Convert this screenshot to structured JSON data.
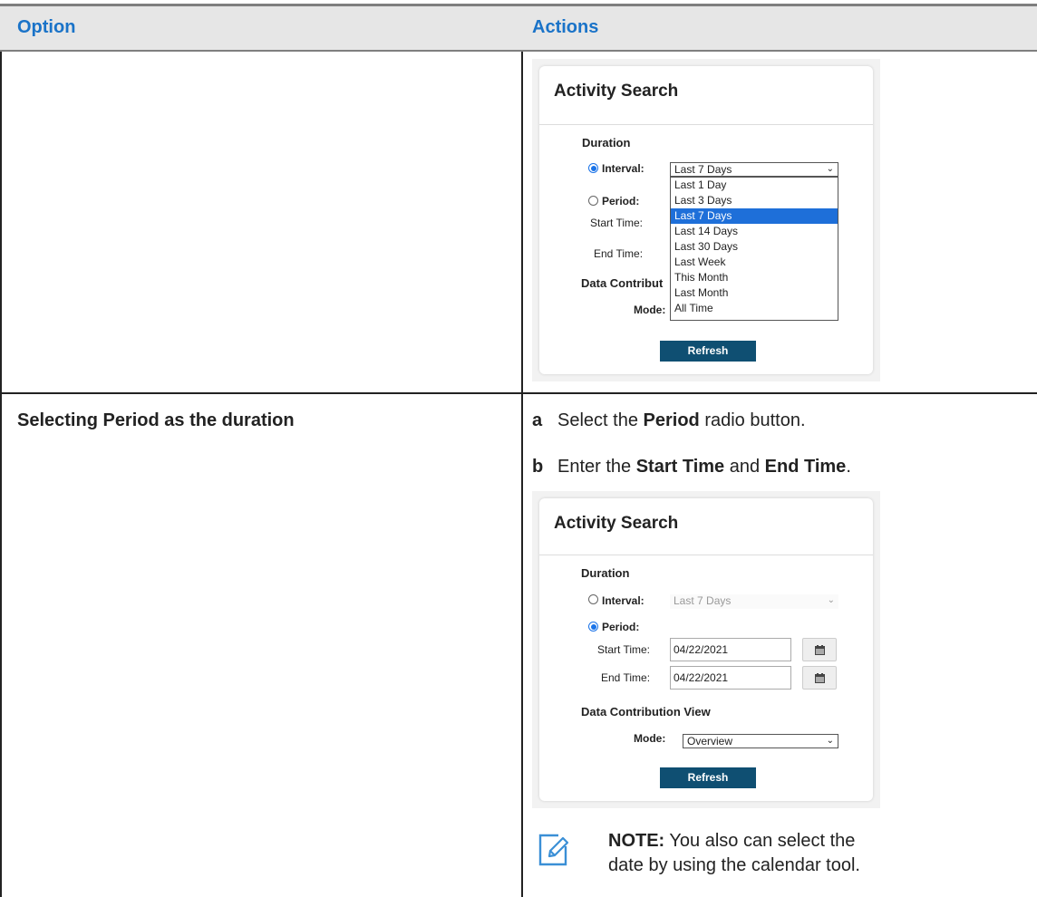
{
  "table": {
    "headers": {
      "option": "Option",
      "actions": "Actions"
    },
    "rows": [
      {
        "option": "",
        "screenshot": {
          "title": "Activity Search",
          "duration_heading": "Duration",
          "interval_label": "Interval:",
          "interval_value": "Last 7 Days",
          "interval_selected": true,
          "period_label": "Period:",
          "start_label": "Start Time:",
          "end_label": "End Time:",
          "data_heading": "Data Contribut",
          "mode_label": "Mode:",
          "dropdown_open": true,
          "dropdown_options": [
            "Last 1 Day",
            "Last 3 Days",
            "Last 7 Days",
            "Last 14 Days",
            "Last 30 Days",
            "Last Week",
            "This Month",
            "Last Month",
            "All Time"
          ],
          "dropdown_selected": "Last 7 Days",
          "refresh_label": "Refresh"
        }
      },
      {
        "option": "Selecting Period as the duration",
        "steps": [
          {
            "letter": "a",
            "pre": "Select the ",
            "bold": "Period",
            "post": " radio button.",
            "bold2": "",
            "post2": ""
          },
          {
            "letter": "b",
            "pre": "Enter the ",
            "bold": "Start Time",
            "post": " and ",
            "bold2": "End Time",
            "post2": "."
          }
        ],
        "screenshot": {
          "title": "Activity Search",
          "duration_heading": "Duration",
          "interval_label": "Interval:",
          "interval_value": "Last 7 Days",
          "period_label": "Period:",
          "period_selected": true,
          "start_label": "Start Time:",
          "start_value": "04/22/2021",
          "end_label": "End Time:",
          "end_value": "04/22/2021",
          "data_heading": "Data Contribution View",
          "mode_label": "Mode:",
          "mode_value": "Overview",
          "refresh_label": "Refresh"
        },
        "note": {
          "label": "NOTE:",
          "text": " You also can select the date by using the calendar tool.",
          "icon": "note-pencil-icon"
        }
      }
    ]
  },
  "colors": {
    "header_text": "#1a73c8",
    "header_bg": "#e6e6e6",
    "refresh_bg": "#0f4f72",
    "highlight": "#1e6fd9"
  }
}
